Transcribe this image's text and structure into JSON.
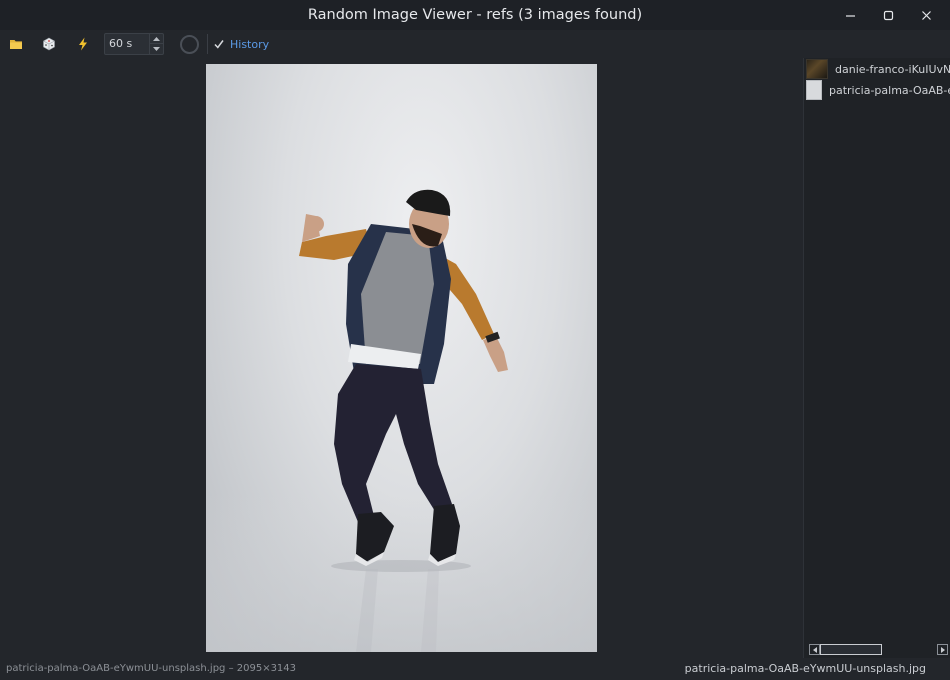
{
  "window": {
    "title": "Random Image Viewer - refs (3 images found)",
    "controls": [
      "minimize-icon",
      "maximize-icon",
      "close-icon"
    ]
  },
  "toolbar": {
    "buttons": [
      {
        "name": "open-folder",
        "icon": "folder-icon"
      },
      {
        "name": "random",
        "icon": "dice-icon"
      },
      {
        "name": "auto-advance",
        "icon": "lightning-icon"
      }
    ],
    "interval_value": "60 s",
    "history_label": "History",
    "history_checked": true,
    "accent_color": "#5b9ae6"
  },
  "viewer": {
    "image_name": "patricia-palma-OaAB-eYwmUU-unsplash.jpg"
  },
  "file_list": {
    "items": [
      {
        "label": "danie-franco-iKuIUvN",
        "thumb": "dark"
      },
      {
        "label": "patricia-palma-OaAB-e",
        "thumb": "light"
      }
    ]
  },
  "status": {
    "left_text": "patricia-palma-OaAB-eYwmUU-unsplash.jpg – 2095×3143",
    "right_text": "patricia-palma-OaAB-eYwmUU-unsplash.jpg"
  }
}
